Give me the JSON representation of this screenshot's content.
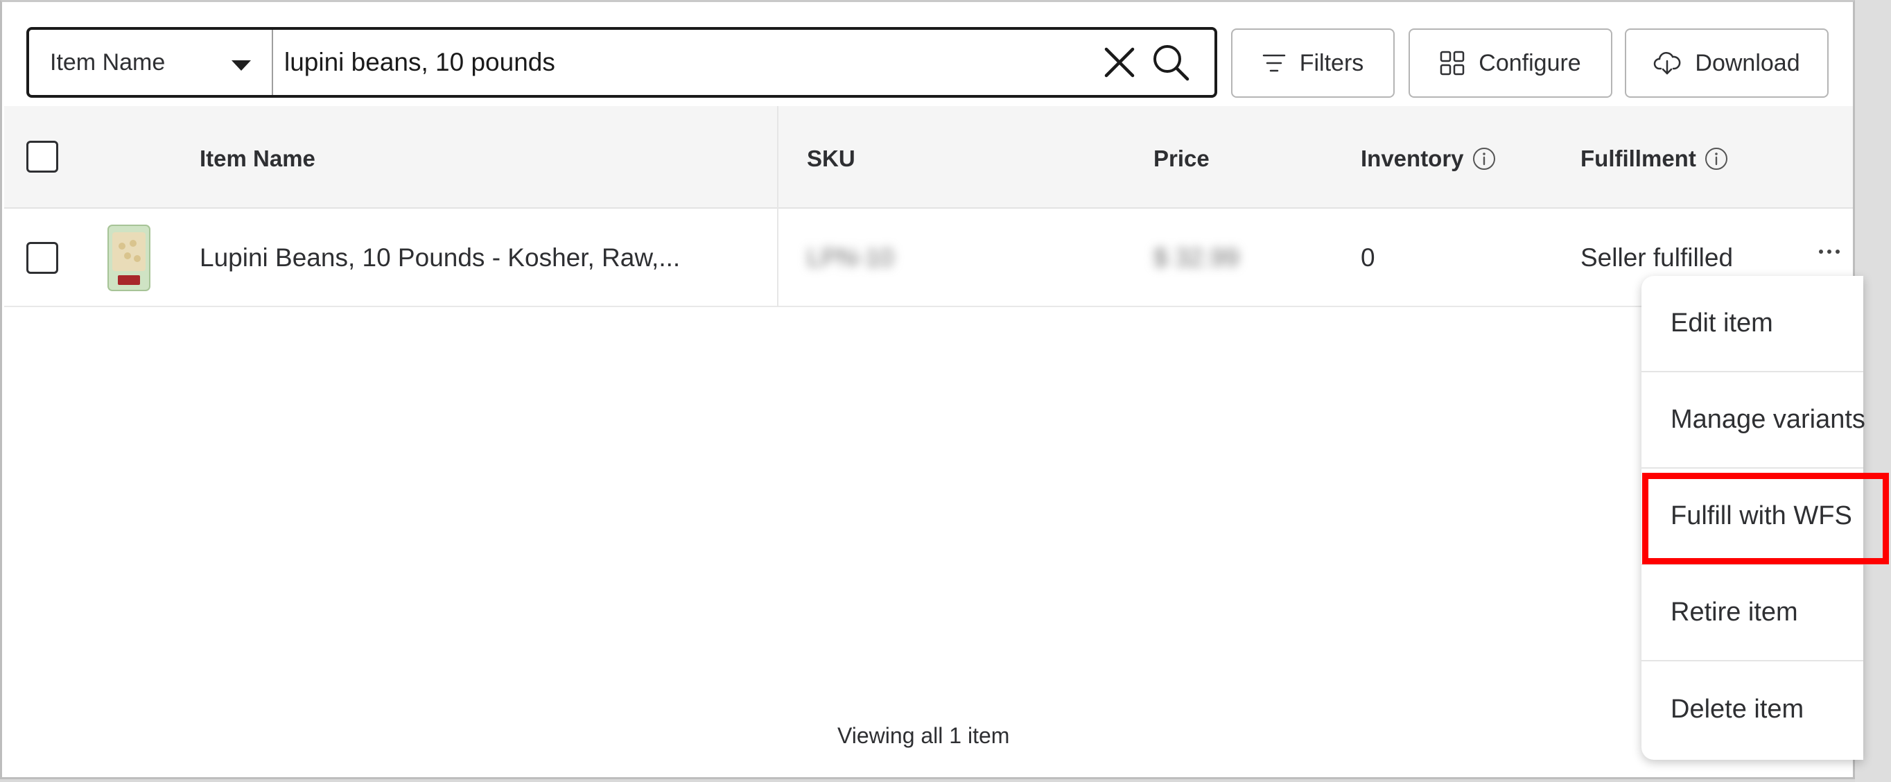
{
  "search": {
    "field_label": "Item Name",
    "query": "lupini beans, 10 pounds"
  },
  "toolbar": {
    "filters_label": "Filters",
    "configure_label": "Configure",
    "download_label": "Download"
  },
  "table": {
    "columns": {
      "item_name": "Item Name",
      "sku": "SKU",
      "price": "Price",
      "inventory": "Inventory",
      "fulfillment": "Fulfillment"
    },
    "rows": [
      {
        "item_name": "Lupini Beans, 10 Pounds - Kosher, Raw,...",
        "sku": "LPN-10",
        "price": "$ 32.99",
        "inventory": "0",
        "fulfillment": "Seller fulfilled"
      }
    ]
  },
  "footer": {
    "summary": "Viewing all 1 item"
  },
  "menu": {
    "items": [
      "Edit item",
      "Manage variants",
      "Fulfill with WFS",
      "Retire item",
      "Delete item"
    ],
    "highlighted_index": 2
  },
  "colors": {
    "highlight": "#ff0000",
    "border": "#1a1a1a",
    "header_bg": "#f5f5f5"
  }
}
